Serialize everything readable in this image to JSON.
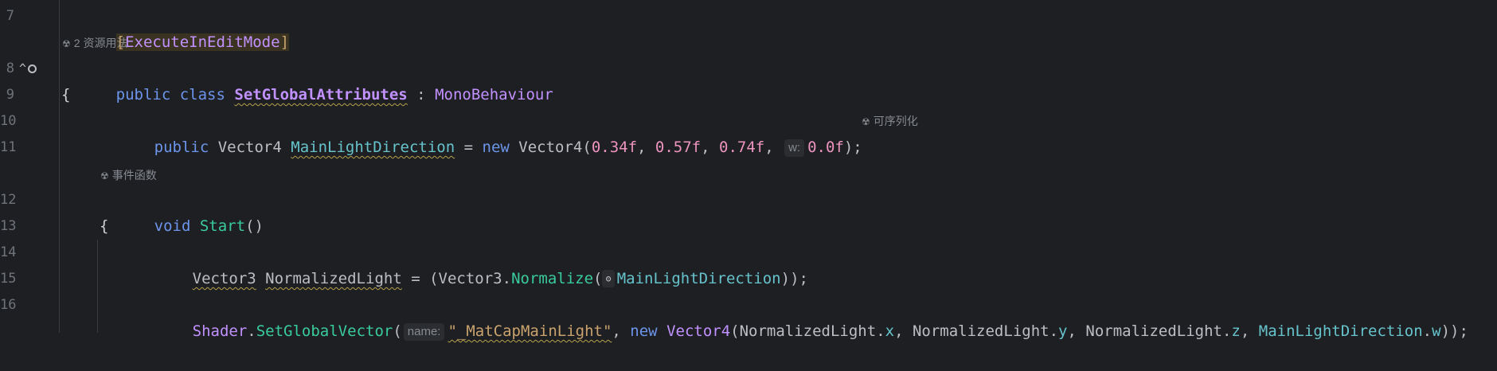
{
  "gutter": {
    "line_numbers": [
      "7",
      "8",
      "9",
      "10",
      "11",
      "12",
      "13",
      "14",
      "15",
      "16"
    ],
    "line8_icons": "^"
  },
  "hints": {
    "usages": "2 资源用法",
    "serializable": "可序列化",
    "event_function": "事件函数",
    "icon_glyph": "☢"
  },
  "code": {
    "l7": {
      "open": "[",
      "attr": "ExecuteInEditMode",
      "close": "]"
    },
    "l8": {
      "kw1": "public",
      "kw2": "class",
      "name": "SetGlobalAttributes",
      "colon": " : ",
      "base": "MonoBehaviour"
    },
    "l9": {
      "brace": "{"
    },
    "l10": {
      "kw1": "public",
      "type": "Vector4",
      "field": "MainLightDirection",
      "eq": " = ",
      "kw_new": "new",
      "ctor": "Vector4",
      "p1": "(",
      "n1": "0.34f",
      "c1": ", ",
      "n2": "0.57f",
      "c2": ", ",
      "n3": "0.74f",
      "c3": ", ",
      "inlay_w": "w:",
      "n4": "0.0f",
      "end": ");"
    },
    "l12": {
      "kw": "void",
      "method": "Start",
      "parens": "()"
    },
    "l13": {
      "brace": "{"
    },
    "l14": {
      "type": "Vector3",
      "var": "NormalizedLight",
      "eq": " = ",
      "p1": "(",
      "cls": "Vector3",
      "dot": ".",
      "method": "Normalize",
      "p2": "(",
      "inlay_icon": "ʘ",
      "arg": "MainLightDirection",
      "end": "));"
    },
    "l16": {
      "cls": "Shader",
      "dot": ".",
      "method": "SetGlobalVector",
      "p1": "(",
      "inlay_name": "name:",
      "str": "\"_MatCapMainLight\"",
      "c1": ", ",
      "kw_new": "new",
      "ctor": "Vector4",
      "p2": "(",
      "v1": "NormalizedLight",
      "d1": ".",
      "f1": "x",
      "c2": ", ",
      "v2": "NormalizedLight",
      "d2": ".",
      "f2": "y",
      "c3": ", ",
      "v3": "NormalizedLight",
      "d3": ".",
      "f3": "z",
      "c4": ", ",
      "v4": "MainLightDirection",
      "d4": ".",
      "f4": "w",
      "end": "));"
    }
  },
  "colors": {
    "background": "#1e1f22",
    "keyword": "#6c95eb",
    "type": "#c191ff",
    "field": "#66c3cc",
    "method": "#39cc9b",
    "number": "#ed94c0",
    "string": "#c9a26d"
  }
}
